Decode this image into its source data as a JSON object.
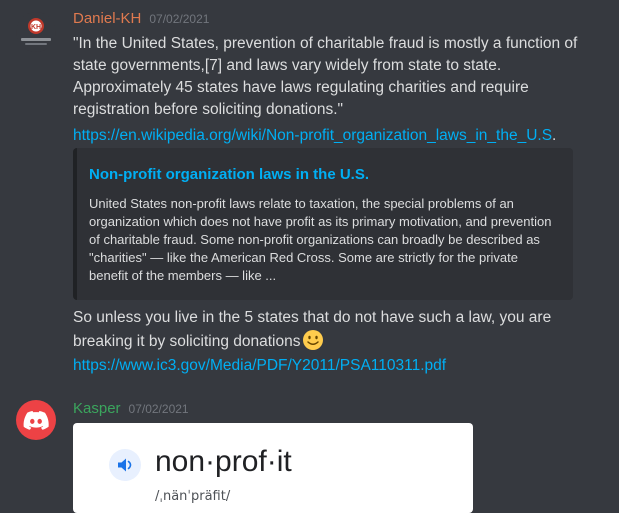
{
  "messages": [
    {
      "author": "Daniel-KH",
      "timestamp": "07/02/2021",
      "author_color": "#e07a4f",
      "avatar_icon": "daniel-kh-avatar",
      "lines": [
        "\"In the United States, prevention of charitable fraud is mostly a function of state governments,[7] and laws vary widely from state to state. Approximately 45 states have laws regulating charities and require registration before soliciting donations.\""
      ],
      "link1": "https://en.wikipedia.org/wiki/Non-profit_organization_laws_in_the_U.S",
      "link1_trail": ".",
      "embed": {
        "title": "Non-profit organization laws in the U.S.",
        "description": "United States non-profit laws relate to taxation, the special problems of an organization which does not have profit as its primary motivation, and prevention of charitable fraud. Some non-profit organizations can broadly be described as \"charities\" — like the American Red Cross. Some are strictly for the private benefit of the members — like ..."
      },
      "text2": "So unless you live in the 5 states that do not have such a law, you are breaking it by soliciting donations",
      "emoji": "slightly-smiling-face-icon",
      "link2": "https://www.ic3.gov/Media/PDF/Y2011/PSA110311.pdf"
    },
    {
      "author": "Kasper",
      "timestamp": "07/02/2021",
      "author_color": "#3ba55d",
      "avatar_icon": "discord-logo-icon",
      "dictionary": {
        "word": "non·prof·it",
        "pronunciation": "/ˌnänˈpräfit/",
        "speaker_icon": "speaker-icon"
      }
    }
  ]
}
